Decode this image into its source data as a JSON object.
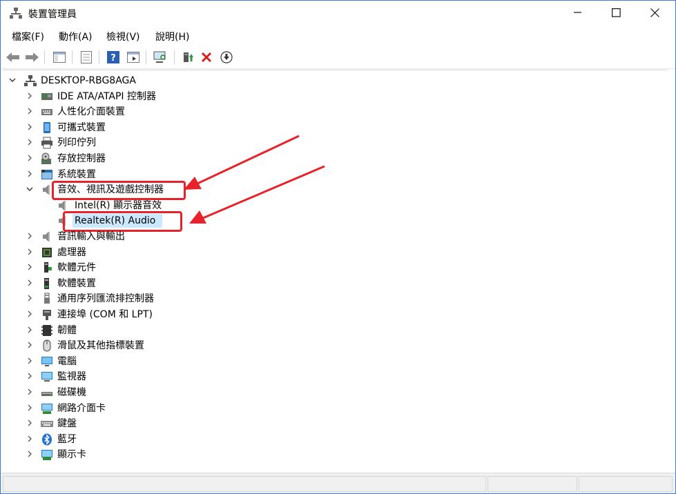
{
  "window": {
    "title": "裝置管理員",
    "controls": {
      "minimize": "—",
      "maximize": "☐",
      "close": "✕"
    }
  },
  "menu": {
    "items": [
      "檔案(F)",
      "動作(A)",
      "檢視(V)",
      "說明(H)"
    ]
  },
  "toolbar": {
    "buttons": [
      "back-icon",
      "forward-icon",
      "show-hide-tree-icon",
      "properties-icon",
      "help-icon",
      "view-icon",
      "scan-hardware-icon",
      "update-driver-icon",
      "uninstall-icon",
      "disable-icon"
    ]
  },
  "tree": {
    "root": "DESKTOP-RBG8AGA",
    "items": [
      {
        "label": "IDE ATA/ATAPI 控制器",
        "icon": "ide-controller-icon"
      },
      {
        "label": "人性化介面裝置",
        "icon": "hid-icon"
      },
      {
        "label": "可攜式裝置",
        "icon": "portable-device-icon"
      },
      {
        "label": "列印佇列",
        "icon": "printer-icon"
      },
      {
        "label": "存放控制器",
        "icon": "storage-controller-icon"
      },
      {
        "label": "系統裝置",
        "icon": "system-device-icon"
      },
      {
        "label": "音效、視訊及遊戲控制器",
        "icon": "speaker-icon",
        "expanded": true,
        "children": [
          {
            "label": "Intel(R) 顯示器音效",
            "icon": "speaker-icon"
          },
          {
            "label": "Realtek(R) Audio",
            "icon": "speaker-icon",
            "selected": true
          }
        ]
      },
      {
        "label": "音訊輸入與輸出",
        "icon": "speaker-icon"
      },
      {
        "label": "處理器",
        "icon": "processor-icon"
      },
      {
        "label": "軟體元件",
        "icon": "software-component-icon"
      },
      {
        "label": "軟體裝置",
        "icon": "software-device-icon"
      },
      {
        "label": "通用序列匯流排控制器",
        "icon": "usb-icon"
      },
      {
        "label": "連接埠 (COM 和 LPT)",
        "icon": "port-icon"
      },
      {
        "label": "韌體",
        "icon": "firmware-icon"
      },
      {
        "label": "滑鼠及其他指標裝置",
        "icon": "mouse-icon"
      },
      {
        "label": "電腦",
        "icon": "computer-icon"
      },
      {
        "label": "監視器",
        "icon": "monitor-icon"
      },
      {
        "label": "磁碟機",
        "icon": "disk-drive-icon"
      },
      {
        "label": "網路介面卡",
        "icon": "network-adapter-icon"
      },
      {
        "label": "鍵盤",
        "icon": "keyboard-icon"
      },
      {
        "label": "藍牙",
        "icon": "bluetooth-icon"
      },
      {
        "label": "顯示卡",
        "icon": "display-adapter-icon"
      }
    ]
  },
  "colors": {
    "accent": "#3a7bd5",
    "selection": "#cce8ff",
    "annotation": "#e8222a"
  }
}
